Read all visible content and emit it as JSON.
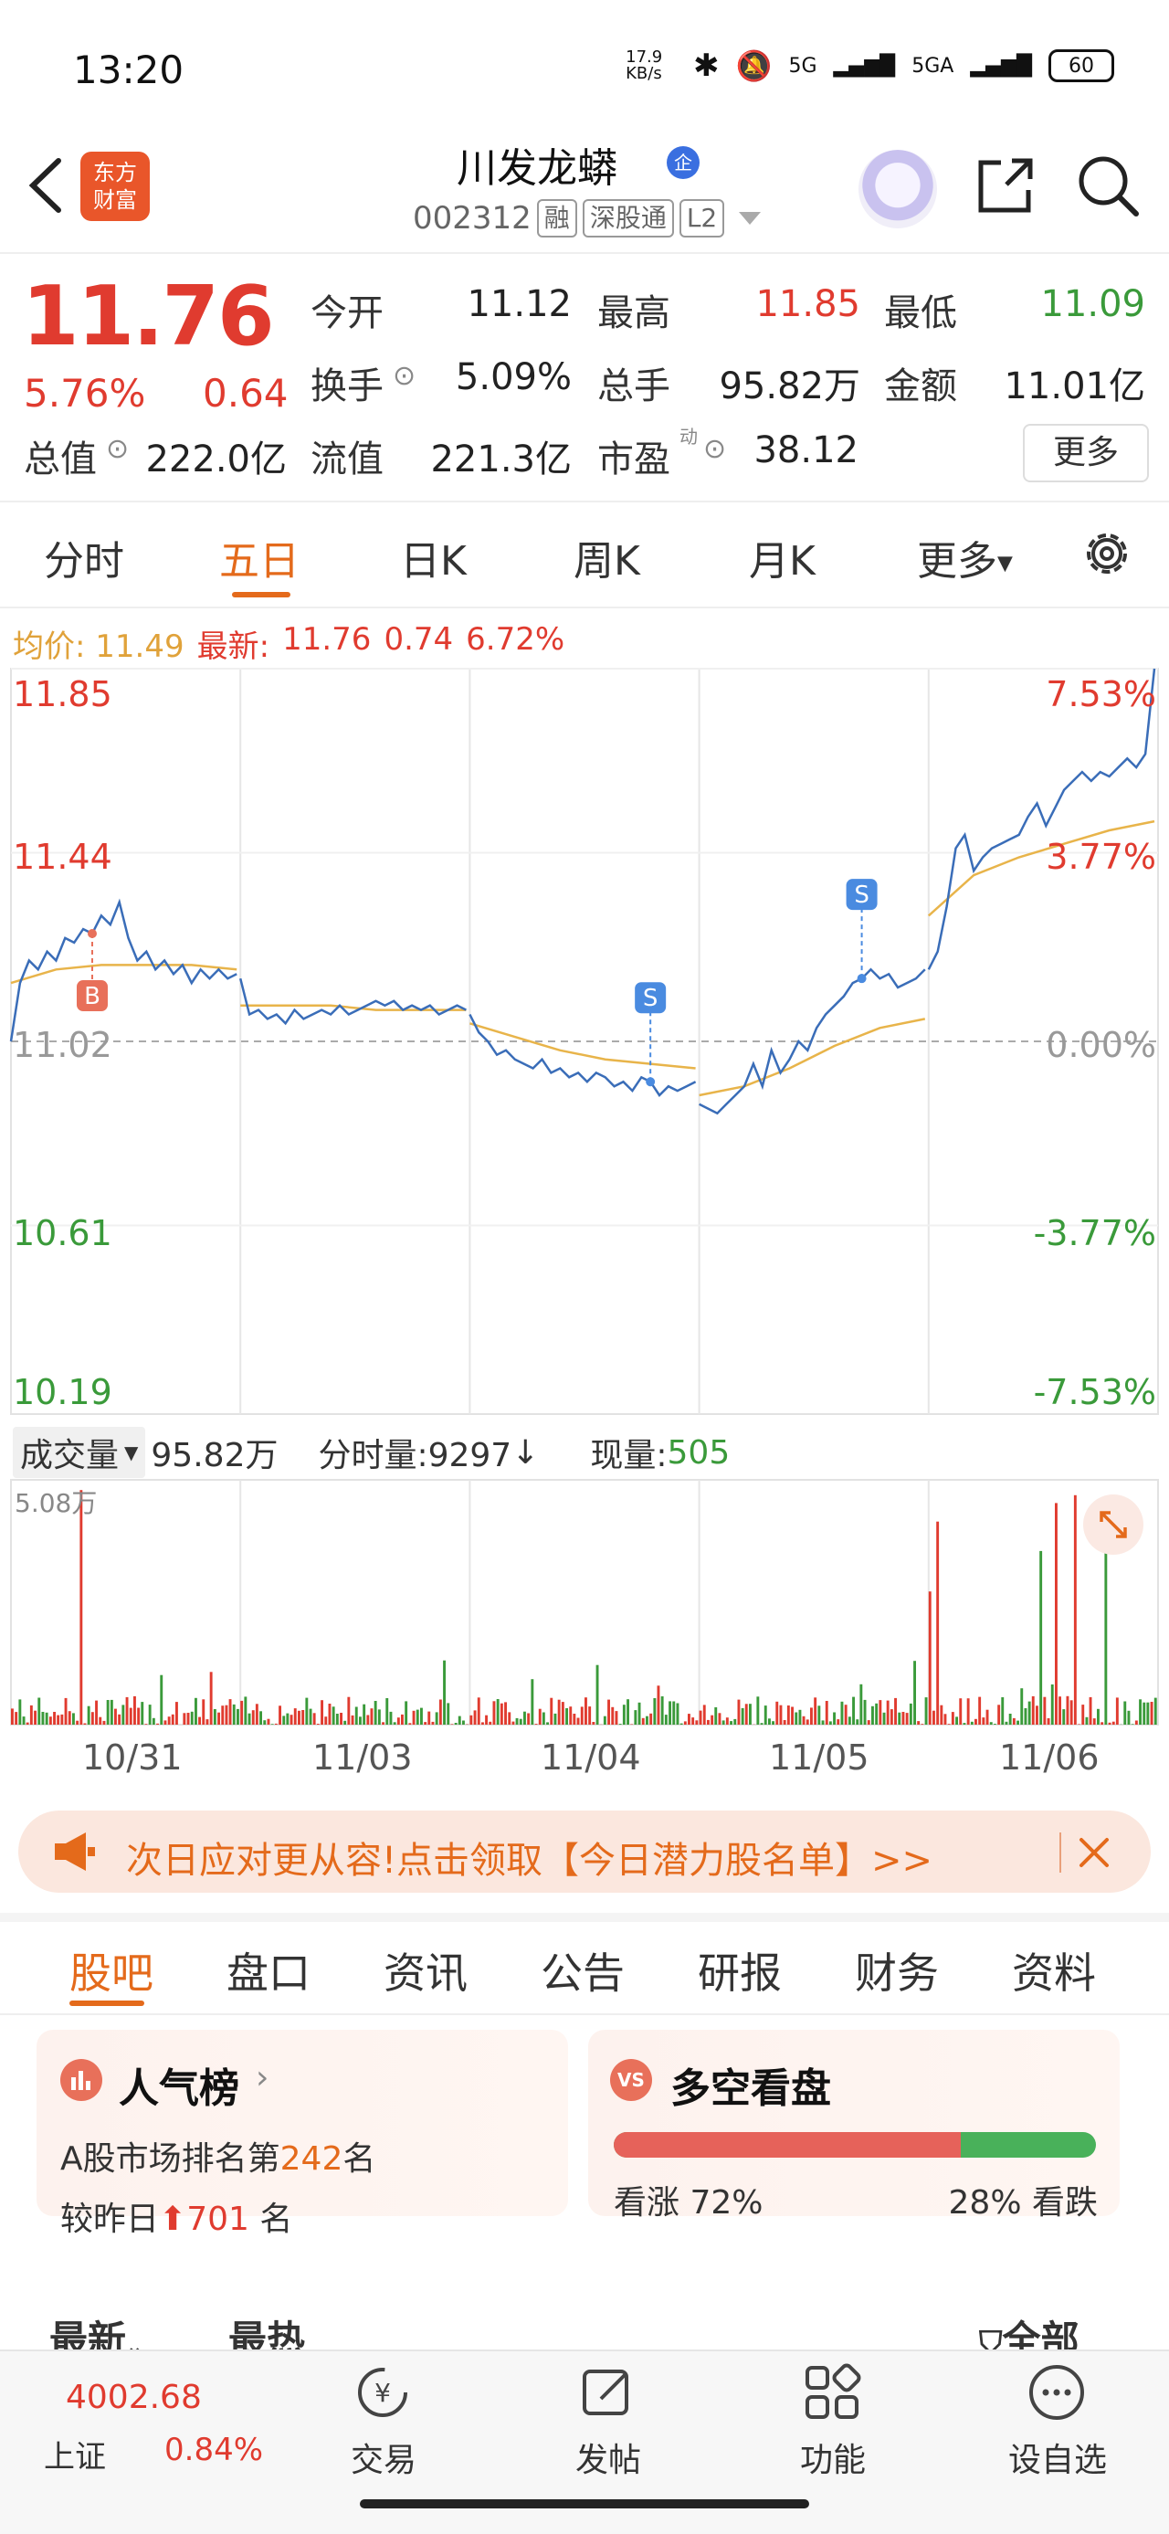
{
  "status_bar": {
    "time": "13:20",
    "net_speed": "17.9 KB/s",
    "sig1": "5G",
    "sig2": "5GA",
    "battery": "60"
  },
  "header": {
    "logo_line1": "东方",
    "logo_line2": "财富",
    "stock_name": "川发龙蟒",
    "name_badge": "企",
    "code": "002312",
    "tag_margin": "融",
    "tag_connect": "深股通",
    "tag_level": "L2"
  },
  "quote": {
    "price": "11.76",
    "change_pct": "5.76%",
    "change_amt": "0.64",
    "open_label": "今开",
    "open": "11.12",
    "high_label": "最高",
    "high": "11.85",
    "low_label": "最低",
    "low": "11.09",
    "turnover_label": "换手",
    "turnover": "5.09%",
    "volume_label": "总手",
    "volume": "95.82万",
    "amount_label": "金额",
    "amount": "11.01亿",
    "mktcap_label": "总值",
    "mktcap": "222.0亿",
    "float_label": "流值",
    "float": "221.3亿",
    "pe_label": "市盈",
    "pe_sup": "动",
    "pe": "38.12",
    "more_button": "更多"
  },
  "period_tabs": [
    "分时",
    "五日",
    "日K",
    "周K",
    "月K",
    "更多"
  ],
  "avg_bar": {
    "avg_label": "均价:",
    "avg": "11.49",
    "latest_label": "最新:",
    "latest": "11.76",
    "chg": "0.74",
    "pct": "6.72%"
  },
  "chart_data": {
    "type": "line",
    "y_left_ticks": [
      "11.85",
      "11.44",
      "11.02",
      "10.61",
      "10.19"
    ],
    "y_right_ticks": [
      "7.53%",
      "3.77%",
      "0.00%",
      "-3.77%",
      "-7.53%"
    ],
    "x_labels": [
      "10/31",
      "11/03",
      "11/04",
      "11/05",
      "11/06"
    ],
    "ylim": [
      10.19,
      11.85
    ],
    "prev_close": 11.02,
    "price_series": [
      [
        11.02,
        11.15,
        11.2,
        11.18,
        11.22,
        11.2,
        11.25,
        11.24,
        11.27,
        11.26,
        11.3,
        11.28,
        11.33,
        11.25,
        11.2,
        11.22,
        11.18,
        11.2,
        11.17,
        11.19,
        11.15,
        11.18,
        11.16,
        11.18,
        11.16,
        11.17
      ],
      [
        11.16,
        11.08,
        11.09,
        11.07,
        11.08,
        11.06,
        11.09,
        11.07,
        11.08,
        11.09,
        11.08,
        11.1,
        11.08,
        11.09,
        11.1,
        11.11,
        11.1,
        11.11,
        11.09,
        11.1,
        11.09,
        11.1,
        11.08,
        11.09,
        11.1,
        11.09
      ],
      [
        11.08,
        11.04,
        11.02,
        10.99,
        11.0,
        10.98,
        10.97,
        10.96,
        10.98,
        10.95,
        10.96,
        10.94,
        10.95,
        10.93,
        10.95,
        10.94,
        10.92,
        10.93,
        10.91,
        10.94,
        10.93,
        10.9,
        10.92,
        10.91,
        10.92,
        10.93
      ],
      [
        10.88,
        10.87,
        10.86,
        10.88,
        10.9,
        10.92,
        10.97,
        10.92,
        11.0,
        10.95,
        10.98,
        11.02,
        11.0,
        11.05,
        11.08,
        11.1,
        11.12,
        11.15,
        11.16,
        11.18,
        11.16,
        11.17,
        11.14,
        11.15,
        11.16,
        11.18
      ],
      [
        11.18,
        11.22,
        11.32,
        11.45,
        11.48,
        11.4,
        11.43,
        11.45,
        11.46,
        11.47,
        11.48,
        11.52,
        11.55,
        11.5,
        11.54,
        11.58,
        11.6,
        11.62,
        11.6,
        11.62,
        11.61,
        11.63,
        11.65,
        11.63,
        11.66,
        11.85
      ]
    ],
    "avg_series": [
      [
        11.15,
        11.18,
        11.19,
        11.19,
        11.19,
        11.18
      ],
      [
        11.1,
        11.1,
        11.1,
        11.09,
        11.09,
        11.09
      ],
      [
        11.06,
        11.03,
        11.0,
        10.98,
        10.97,
        10.96
      ],
      [
        10.9,
        10.92,
        10.96,
        11.01,
        11.05,
        11.07
      ],
      [
        11.3,
        11.39,
        11.43,
        11.46,
        11.49,
        11.51
      ]
    ],
    "buy_marker": {
      "day": 0,
      "pos": 0.35,
      "label": "B"
    },
    "sell_markers": [
      {
        "day": 2,
        "pos": 0.81,
        "label": "S"
      },
      {
        "day": 3,
        "pos": 0.7,
        "label": "S"
      }
    ],
    "volume_max_label": "5.08万"
  },
  "volume_bar": {
    "label": "成交量",
    "total": "95.82万",
    "tick_label": "分时量:9297",
    "tick_arrow": "↓",
    "now_label": "现量:",
    "now": "505"
  },
  "banner": {
    "text": "次日应对更从容!点击领取【今日潜力股名单】>>"
  },
  "content_tabs": [
    "股吧",
    "盘口",
    "资讯",
    "公告",
    "研报",
    "财务",
    "资料"
  ],
  "popularity_card": {
    "title": "人气榜",
    "line1_prefix": "A股市场排名第",
    "rank": "242",
    "line1_suffix": "名",
    "line2_prefix": "较昨日",
    "delta": "701",
    "line2_suffix": "名"
  },
  "sentiment_card": {
    "title": "多空看盘",
    "bull_label": "看涨",
    "bull_pct": "72%",
    "bear_pct": "28%",
    "bear_label": "看跌",
    "bull_fraction": 0.72
  },
  "feed_tabs": {
    "latest": "最新",
    "hot": "最热",
    "all": "全部"
  },
  "bottom_bar": {
    "index_value": "4002.68",
    "index_name": "上证",
    "index_pct": "0.84%",
    "items": [
      "交易",
      "发帖",
      "功能",
      "设自选"
    ]
  },
  "colors": {
    "up": "#e03b2f",
    "down": "#3a9a3a",
    "accent": "#e46a1b",
    "line": "#3a6db8",
    "avg": "#e8b44a"
  }
}
